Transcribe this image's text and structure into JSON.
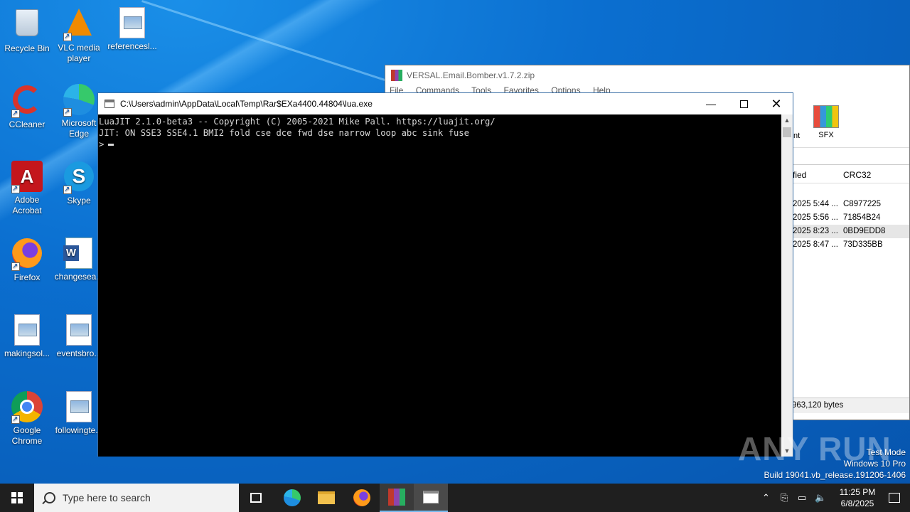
{
  "desktop": {
    "icons": [
      {
        "label": "Recycle Bin"
      },
      {
        "label": "VLC media player"
      },
      {
        "label": "referencesl..."
      },
      {
        "label": "CCleaner"
      },
      {
        "label": "Microsoft Edge"
      },
      {
        "label": "Adobe Acrobat"
      },
      {
        "label": "Skype"
      },
      {
        "label": "Firefox"
      },
      {
        "label": "changesea..."
      },
      {
        "label": "makingsol..."
      },
      {
        "label": "eventsbro..."
      },
      {
        "label": "Google Chrome"
      },
      {
        "label": "followingte..."
      }
    ]
  },
  "winrar": {
    "title": "VERSAL.Email.Bomber.v1.7.2.zip",
    "menu": [
      "File",
      "Commands",
      "Tools",
      "Favorites",
      "Options",
      "Help"
    ],
    "toolbar_partial_label": "nt",
    "sfx_label": "SFX",
    "columns": {
      "modified": "fied",
      "crc": "CRC32"
    },
    "rows": [
      {
        "modified": "2025 5:44 ...",
        "crc": "C8977225"
      },
      {
        "modified": "2025 5:56 ...",
        "crc": "71854B24"
      },
      {
        "modified": "2025 8:23 ...",
        "crc": "0BD9EDD8"
      },
      {
        "modified": "2025 8:47 ...",
        "crc": "73D335BB"
      }
    ],
    "status": "963,120 bytes"
  },
  "console": {
    "title": "C:\\Users\\admin\\AppData\\Local\\Temp\\Rar$EXa4400.44804\\lua.exe",
    "lines": [
      "LuaJIT 2.1.0-beta3 -- Copyright (C) 2005-2021 Mike Pall. https://luajit.org/",
      "JIT: ON SSE3 SSE4.1 BMI2 fold cse dce fwd dse narrow loop abc sink fuse"
    ],
    "prompt": ">"
  },
  "watermark": {
    "logo": "ANY RUN",
    "mode": "Test Mode",
    "os": "Windows 10 Pro",
    "build": "Build 19041.vb_release.191206-1406"
  },
  "taskbar": {
    "search_placeholder": "Type here to search",
    "time": "11:25 PM",
    "date": "6/8/2025"
  }
}
